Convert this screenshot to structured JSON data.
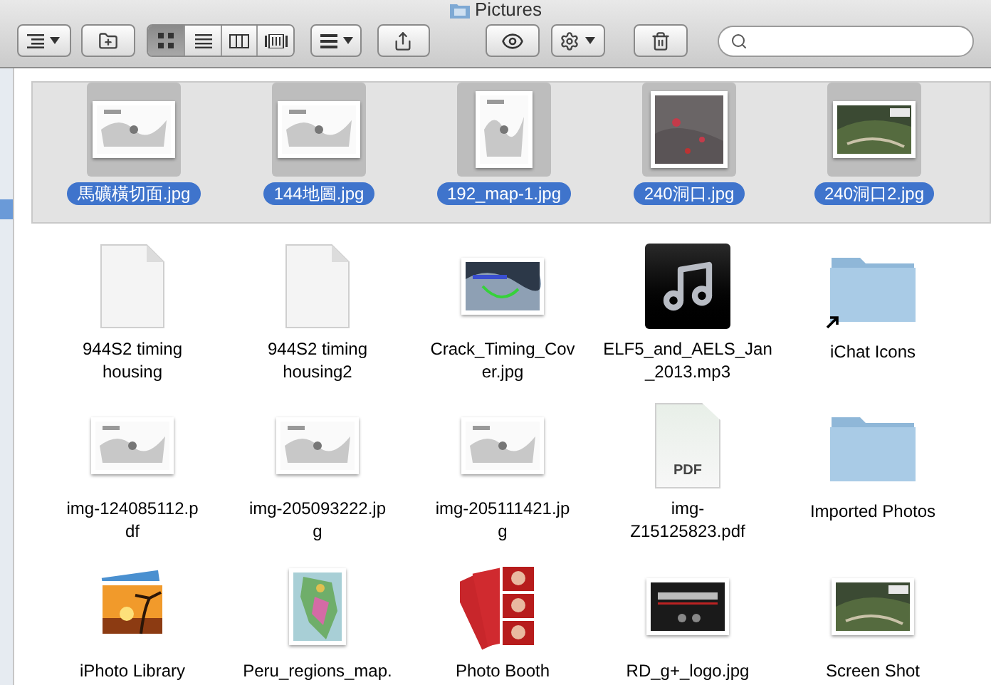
{
  "window": {
    "title": "Pictures"
  },
  "toolbar": {
    "view_modes": [
      {
        "kind": "icon",
        "selected": true
      },
      {
        "kind": "list",
        "selected": false
      },
      {
        "kind": "column",
        "selected": false
      },
      {
        "kind": "cover-flow",
        "selected": false
      }
    ]
  },
  "files": [
    {
      "lines": [
        "馬礦橫切面.jpg"
      ],
      "selected": true
    },
    {
      "lines": [
        "144地圖.jpg"
      ],
      "selected": true
    },
    {
      "lines": [
        "192_map-1.jpg"
      ],
      "selected": true
    },
    {
      "lines": [
        "240洞口.jpg"
      ],
      "selected": true
    },
    {
      "lines": [
        "240洞口2.jpg"
      ],
      "selected": true
    },
    {
      "kind": "document",
      "lines": [
        "944S2 timing",
        "housing"
      ],
      "selected": false
    },
    {
      "kind": "document",
      "lines": [
        "944S2 timing",
        "housing2"
      ],
      "selected": false
    },
    {
      "lines": [
        "Crack_Timing_Cov",
        "er.jpg"
      ],
      "selected": false
    },
    {
      "kind": "music",
      "lines": [
        "ELF5_and_AELS_Jan",
        "_2013.mp3"
      ],
      "selected": false
    },
    {
      "kind": "folder",
      "lines": [
        "iChat Icons"
      ],
      "selected": false,
      "alias": true
    },
    {
      "lines": [
        "img-124085112.p",
        "df"
      ],
      "selected": false
    },
    {
      "lines": [
        "img-205093222.jp",
        "g"
      ],
      "selected": false
    },
    {
      "lines": [
        "img-205111421.jp",
        "g"
      ],
      "selected": false
    },
    {
      "kind": "pdf",
      "lines": [
        "img-",
        "Z15125823.pdf"
      ],
      "selected": false,
      "badge": "PDF"
    },
    {
      "kind": "folder",
      "lines": [
        "Imported Photos"
      ],
      "selected": false,
      "alias": false
    },
    {
      "kind": "photo-library",
      "lines": [
        "iPhoto Library"
      ],
      "selected": false
    },
    {
      "lines": [
        "Peru_regions_map."
      ],
      "selected": false
    },
    {
      "kind": "photo-booth",
      "lines": [
        "Photo Booth"
      ],
      "selected": false
    },
    {
      "lines": [
        "RD_g+_logo.jpg"
      ],
      "selected": false
    },
    {
      "lines": [
        "Screen Shot"
      ],
      "selected": false
    }
  ]
}
